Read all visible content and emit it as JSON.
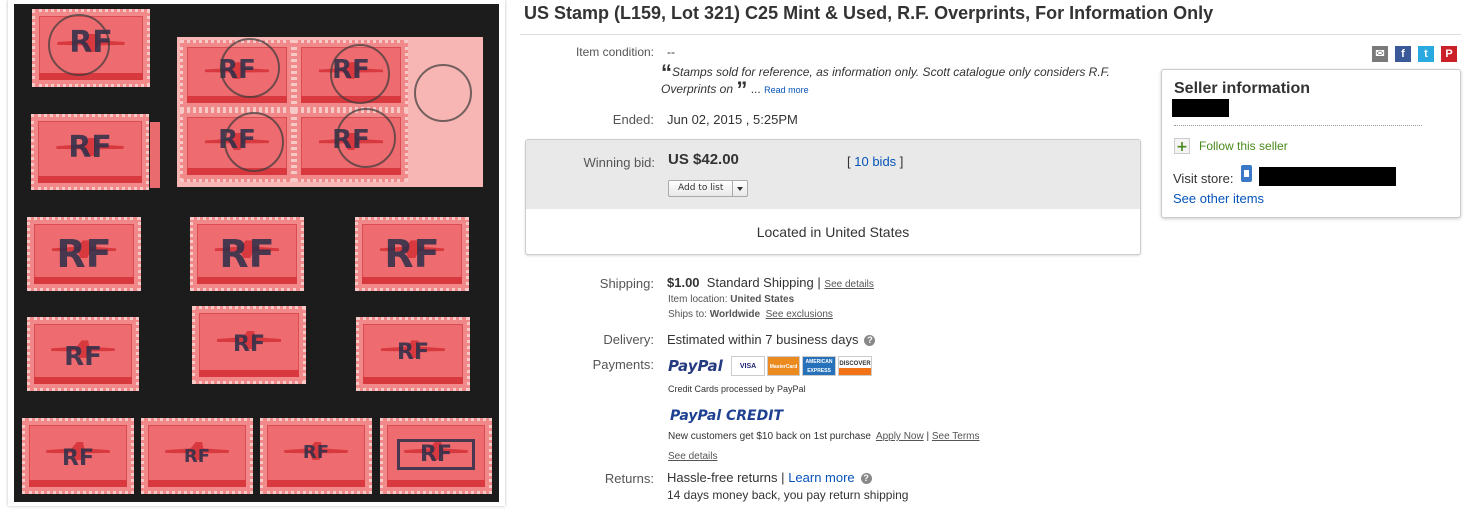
{
  "listing": {
    "title": "US Stamp (L159, Lot 321) C25 Mint & Used, R.F. Overprints, For Information Only",
    "overprint_text": "RF"
  },
  "details": {
    "condition_label": "Item condition:",
    "condition_value": "--",
    "quote_text": "Stamps sold for reference, as information only. Scott catalogue only considers R.F. Overprints on",
    "quote_more_prefix": "...",
    "read_more": "Read more",
    "ended_label": "Ended:",
    "ended_value": "Jun 02, 2015 , 5:25PM"
  },
  "bid": {
    "label": "Winning bid:",
    "amount": "US $42.00",
    "bids_open": "[",
    "bids_link": "10 bids",
    "bids_close": "]",
    "add_to_list": "Add to list",
    "located": "Located in United States"
  },
  "shipping": {
    "label": "Shipping:",
    "cost": "$1.00",
    "method": "Standard Shipping",
    "sep": "|",
    "see_details": "See details",
    "location_label": "Item location:",
    "location_value": "United States",
    "ships_to_label": "Ships to:",
    "ships_to_value": "Worldwide",
    "see_exclusions": "See exclusions"
  },
  "delivery": {
    "label": "Delivery:",
    "value": "Estimated within 7 business days",
    "help": "?"
  },
  "payments": {
    "label": "Payments:",
    "paypal": "PayPal",
    "cards": [
      "VISA",
      "MasterCard",
      "AMERICAN EXPRESS",
      "DISCOVER"
    ],
    "processed": "Credit Cards processed by PayPal",
    "credit_logo": "PayPal CREDIT",
    "promo": "New customers get $10 back on 1st purchase",
    "apply_now": "Apply Now",
    "sep": "|",
    "see_terms": "See Terms",
    "see_details": "See details"
  },
  "returns": {
    "label": "Returns:",
    "value": "Hassle-free returns",
    "sep": "|",
    "learn_more": "Learn more",
    "help": "?",
    "policy": "14 days money back, you pay return shipping"
  },
  "seller": {
    "heading": "Seller information",
    "follow_icon": "+",
    "follow": "Follow this seller",
    "visit_store": "Visit store:",
    "see_other": "See other items"
  },
  "share": {
    "icons": [
      "email-icon",
      "facebook-icon",
      "twitter-icon",
      "pinterest-icon"
    ],
    "glyphs": [
      "✉",
      "f",
      "t",
      "P"
    ],
    "colors": [
      "#7a7a7a",
      "#3b5998",
      "#2aa9e0",
      "#cb2027"
    ]
  },
  "colors": {
    "link": "#0654ba",
    "photo_bg": "#1c1c1c",
    "stamp": "#ee6b6f",
    "follow_green": "#4a8a1c"
  }
}
